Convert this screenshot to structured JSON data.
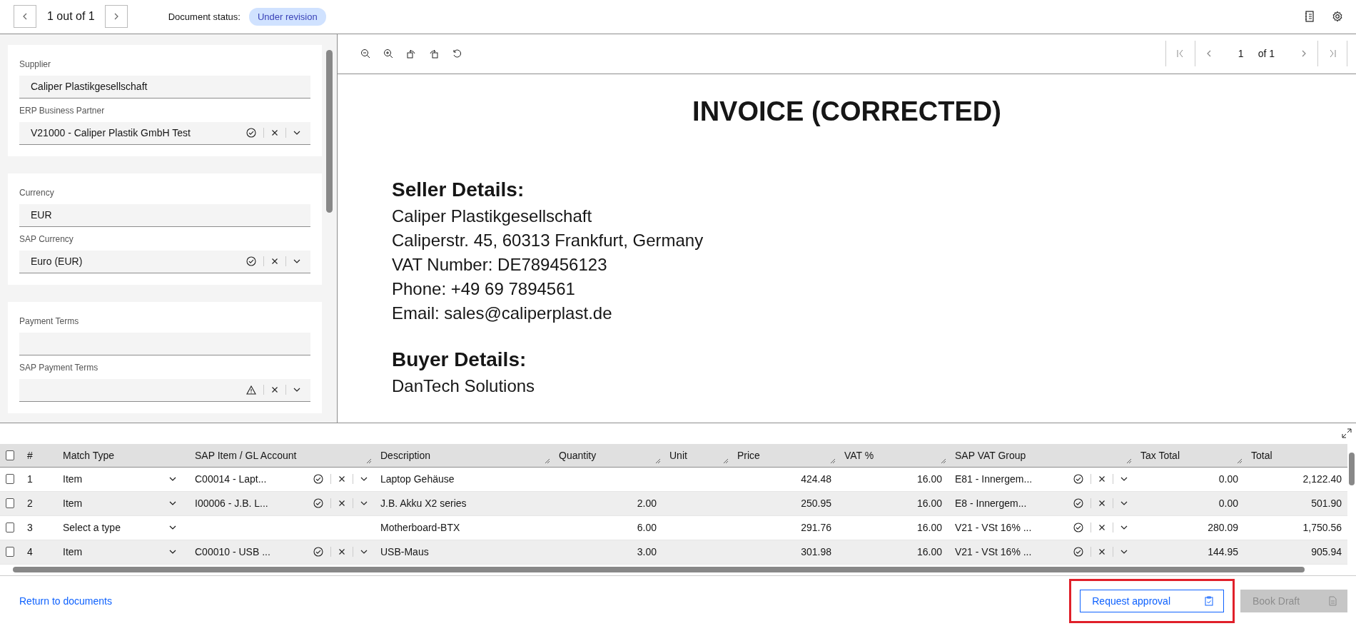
{
  "pager": {
    "counter": "1 out of 1"
  },
  "status": {
    "label": "Document status:",
    "value": "Under revision"
  },
  "sections": [
    {
      "fields": [
        {
          "label": "Supplier",
          "kind": "text",
          "value": "Caliper Plastikgesellschaft"
        },
        {
          "label": "ERP Business Partner",
          "kind": "lookup",
          "value": "V21000 - Caliper Plastik GmbH Test",
          "verified": true
        }
      ]
    },
    {
      "fields": [
        {
          "label": "Currency",
          "kind": "text",
          "value": "EUR"
        },
        {
          "label": "SAP Currency",
          "kind": "lookup",
          "value": "Euro (EUR)",
          "verified": true
        }
      ]
    },
    {
      "fields": [
        {
          "label": "Payment Terms",
          "kind": "text"
        },
        {
          "label": "SAP Payment Terms",
          "kind": "lookup",
          "verified": false
        }
      ]
    }
  ],
  "viewer": {
    "page": "1",
    "page_total": "of 1"
  },
  "document": {
    "title": "INVOICE (CORRECTED)",
    "sections": [
      {
        "heading": "Seller Details:",
        "lines": [
          "Caliper Plastikgesellschaft",
          "Caliperstr. 45, 60313 Frankfurt, Germany",
          "VAT Number: DE789456123",
          "Phone: +49 69 7894561",
          "Email: sales@caliperplast.de"
        ]
      },
      {
        "heading": "Buyer Details:",
        "lines": [
          "DanTech Solutions"
        ]
      }
    ]
  },
  "table": {
    "all_checked": false,
    "columns": [
      {
        "label": "#",
        "resizable": false
      },
      {
        "label": "Match Type",
        "resizable": false
      },
      {
        "label": "SAP Item / GL Account",
        "resizable": true
      },
      {
        "label": "Description",
        "resizable": true
      },
      {
        "label": "Quantity",
        "resizable": true
      },
      {
        "label": "Unit",
        "resizable": true
      },
      {
        "label": "Price",
        "resizable": true
      },
      {
        "label": "VAT %",
        "resizable": true
      },
      {
        "label": "SAP VAT Group",
        "resizable": true
      },
      {
        "label": "Tax Total",
        "resizable": true
      },
      {
        "label": "Total",
        "resizable": false
      }
    ],
    "rows": [
      {
        "checked": false,
        "num": "1",
        "match_type": "Item",
        "sap_item": "C00014 - Lapt...",
        "description": "Laptop Gehäuse",
        "price": "424.48",
        "vat": "16.00",
        "vat_group": "E81 - Innergem...",
        "tax_total": "0.00",
        "total": "2,122.40"
      },
      {
        "checked": false,
        "num": "2",
        "match_type": "Item",
        "sap_item": "I00006 - J.B. L...",
        "description": "J.B. Akku X2 series",
        "quantity": "2.00",
        "price": "250.95",
        "vat": "16.00",
        "vat_group": "E8 - Innergem...",
        "tax_total": "0.00",
        "total": "501.90"
      },
      {
        "checked": false,
        "num": "3",
        "match_type": "Select a type",
        "description": "Motherboard-BTX",
        "quantity": "6.00",
        "price": "291.76",
        "vat": "16.00",
        "vat_group": "V21 - VSt 16% ...",
        "tax_total": "280.09",
        "total": "1,750.56"
      },
      {
        "checked": false,
        "num": "4",
        "match_type": "Item",
        "sap_item": "C00010 - USB ...",
        "description": "USB-Maus",
        "quantity": "3.00",
        "price": "301.98",
        "vat": "16.00",
        "vat_group": "V21 - VSt 16% ...",
        "tax_total": "144.95",
        "total": "905.94"
      }
    ]
  },
  "footer": {
    "link": "Return to documents",
    "buttons": [
      {
        "label": "Request approval",
        "disabled": false,
        "highlighted": true
      },
      {
        "label": "Book Draft",
        "disabled": true,
        "highlighted": false
      }
    ]
  }
}
